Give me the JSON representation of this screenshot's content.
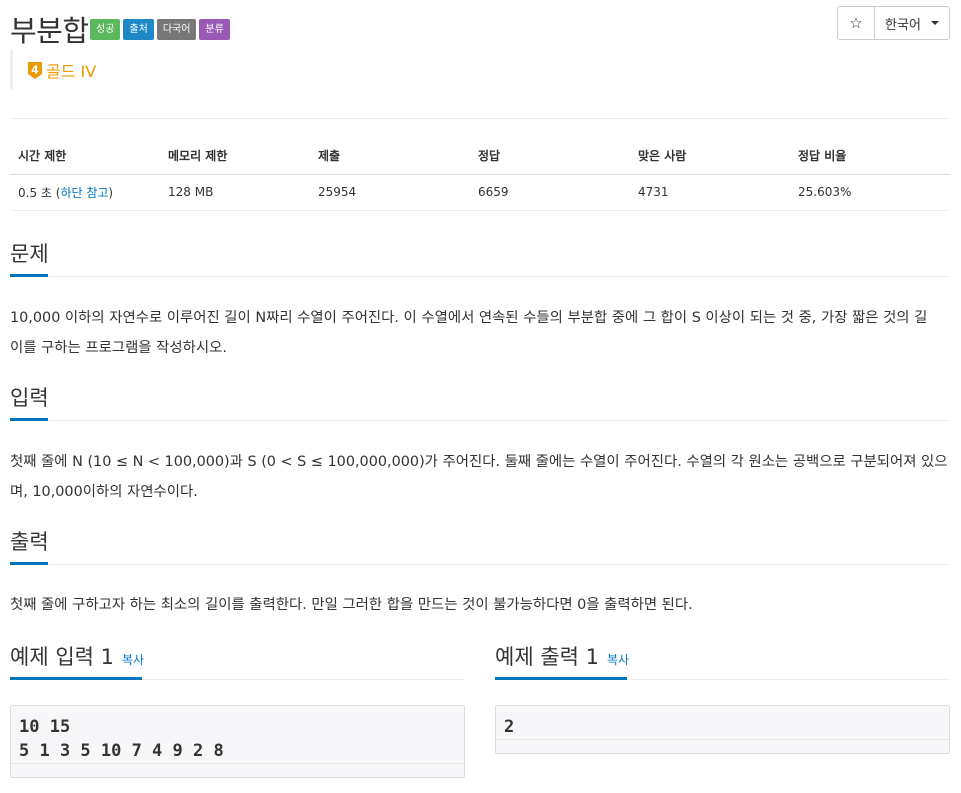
{
  "problem": {
    "title": "부분합",
    "labels": [
      {
        "text": "성공",
        "color": "#5cb85c"
      },
      {
        "text": "출처",
        "color": "#1e88c7"
      },
      {
        "text": "다국어",
        "color": "#777777"
      },
      {
        "text": "분류",
        "color": "#9b59b6"
      }
    ],
    "tier": {
      "level": "4",
      "text": "골드 IV",
      "color": "#ec9a00"
    }
  },
  "toolbar": {
    "star_icon": "☆",
    "language": "한국어"
  },
  "info": {
    "headers": [
      "시간 제한",
      "메모리 제한",
      "제출",
      "정답",
      "맞은 사람",
      "정답 비율"
    ],
    "time_limit_prefix": "0.5 초 (",
    "time_limit_link": "하단 참고",
    "time_limit_suffix": ")",
    "memory": "128 MB",
    "submissions": "25954",
    "accepted": "6659",
    "solvers": "4731",
    "ratio": "25.603%"
  },
  "sections": {
    "description": {
      "title": "문제",
      "lines": [
        "10,000 이하의 자연수로 이루어진 길이 N짜리 수열이 주어진다. 이 수열에서 연속된 수들의 부분합 중에 그 합이 S 이상이 되는 것 중, 가장 짧은 것의 길",
        "이를 구하는 프로그램을 작성하시오."
      ]
    },
    "input": {
      "title": "입력",
      "lines": [
        "첫째 줄에 N (10 ≤ N < 100,000)과 S (0 < S ≤ 100,000,000)가 주어진다. 둘째 줄에는 수열이 주어진다. 수열의 각 원소는 공백으로 구분되어져 있으",
        "며, 10,000이하의 자연수이다."
      ]
    },
    "output": {
      "title": "출력",
      "lines": [
        "첫째 줄에 구하고자 하는 최소의 길이를 출력한다. 만일 그러한 합을 만드는 것이 불가능하다면 0을 출력하면 된다."
      ]
    }
  },
  "samples": {
    "copy_label": "복사",
    "input": {
      "title": "예제 입력 1",
      "lines": [
        "10 15",
        "5 1 3 5 10 7 4 9 2 8"
      ]
    },
    "output": {
      "title": "예제 출력 1",
      "lines": [
        "2"
      ]
    }
  },
  "colors": {
    "accent": "#0076c0",
    "tier": "#ec9a00"
  }
}
